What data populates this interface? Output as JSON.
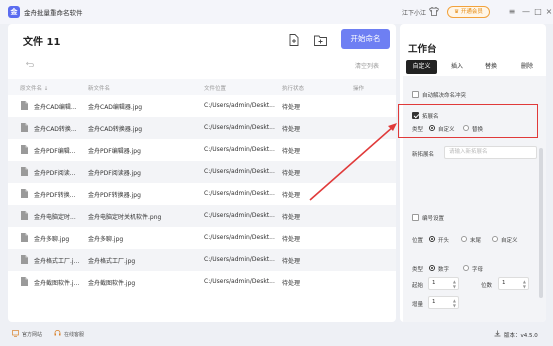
{
  "app": {
    "logo_text": "金",
    "title": "金舟批量重命名软件",
    "user_name": "江下小江",
    "vip_label": "开通会员",
    "window_controls": {
      "menu": "≡",
      "minimize": "—",
      "maximize": "□",
      "close": "×"
    }
  },
  "main": {
    "file_count": "文件 11",
    "start_button": "开始命名",
    "clear_list": "清空列表",
    "columns": [
      "原文件名 ↓",
      "新文件名",
      "文件位置",
      "执行状态",
      "操作"
    ],
    "rows": [
      {
        "orig": "金舟CAD编辑...",
        "new": "金舟CAD编辑器.jpg",
        "path": "C:/Users/admin/Deskt...",
        "status": "待处理"
      },
      {
        "orig": "金舟CAD转换...",
        "new": "金舟CAD转换器.jpg",
        "path": "C:/Users/admin/Deskt...",
        "status": "待处理"
      },
      {
        "orig": "金舟PDF编辑...",
        "new": "金舟PDF编辑器.jpg",
        "path": "C:/Users/admin/Deskt...",
        "status": "待处理"
      },
      {
        "orig": "金舟PDF阅读...",
        "new": "金舟PDF阅读器.jpg",
        "path": "C:/Users/admin/Deskt...",
        "status": "待处理"
      },
      {
        "orig": "金舟PDF转换...",
        "new": "金舟PDF转换器.jpg",
        "path": "C:/Users/admin/Deskt...",
        "status": "待处理"
      },
      {
        "orig": "金舟电脑定时...",
        "new": "金舟电脑定时关机软件.png",
        "path": "C:/Users/admin/Deskt...",
        "status": "待处理"
      },
      {
        "orig": "金舟多聊.jpg",
        "new": "金舟多聊.jpg",
        "path": "C:/Users/admin/Deskt...",
        "status": "待处理"
      },
      {
        "orig": "金舟格式工厂.j...",
        "new": "金舟格式工厂.jpg",
        "path": "C:/Users/admin/Deskt...",
        "status": "待处理"
      },
      {
        "orig": "金舟截图软件.j...",
        "new": "金舟截图软件.jpg",
        "path": "C:/Users/admin/Deskt...",
        "status": "待处理"
      }
    ]
  },
  "workbench": {
    "title": "工作台",
    "tabs": [
      "自定义",
      "插入",
      "替换",
      "删除"
    ],
    "auto_resolve": "自动解决命名冲突",
    "extension": {
      "label": "拓展名",
      "type_label": "类型",
      "options": [
        "自定义",
        "替换"
      ],
      "new_ext_label": "新拓展名",
      "new_ext_placeholder": "请输入新拓展名"
    },
    "numbering": {
      "label": "编号设置",
      "position_label": "位置",
      "positions": [
        "开头",
        "末尾",
        "自定义"
      ],
      "type_label": "类型",
      "types": [
        "数字",
        "字母"
      ],
      "start_label": "起始",
      "start_value": "1",
      "digits_label": "位数",
      "digits_value": "1",
      "step_label": "增量",
      "step_value": "1"
    }
  },
  "statusbar": {
    "website": "官方网站",
    "support": "在线客服",
    "version": "版本：v4.5.0"
  },
  "colors": {
    "accent": "#6e7ff3",
    "vip": "#f2a23c",
    "highlight": "#e03a3a"
  }
}
